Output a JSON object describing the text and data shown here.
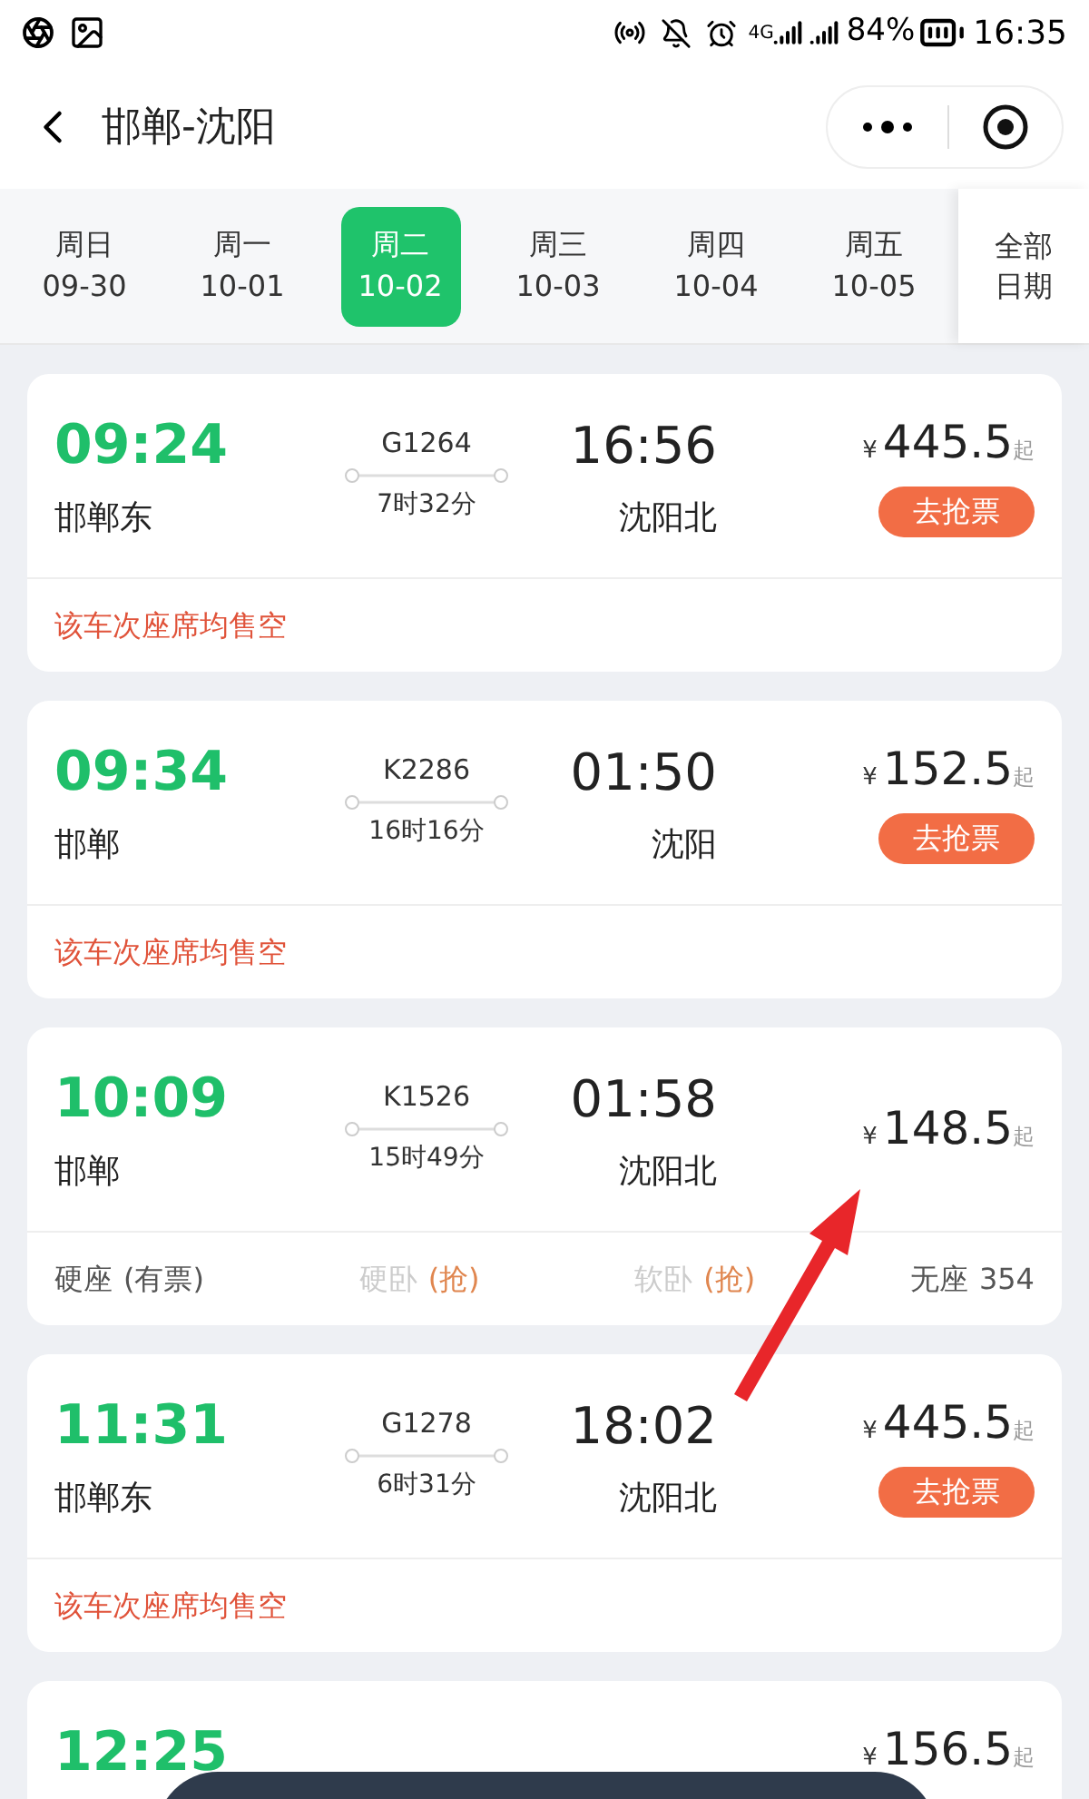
{
  "status_bar": {
    "network": "4G",
    "battery": "84%",
    "time": "16:35"
  },
  "header": {
    "title": "邯郸-沈阳"
  },
  "dates": [
    {
      "weekday": "周日",
      "date": "09-30",
      "selected": false
    },
    {
      "weekday": "周一",
      "date": "10-01",
      "selected": false
    },
    {
      "weekday": "周二",
      "date": "10-02",
      "selected": true
    },
    {
      "weekday": "周三",
      "date": "10-03",
      "selected": false
    },
    {
      "weekday": "周四",
      "date": "10-04",
      "selected": false
    },
    {
      "weekday": "周五",
      "date": "10-05",
      "selected": false
    }
  ],
  "all_dates": "全部日期",
  "trains": [
    {
      "kind": "sold_out",
      "dep_time": "09:24",
      "dep_station": "邯郸东",
      "train_no": "G1264",
      "duration": "7时32分",
      "arr_time": "16:56",
      "arr_station": "沈阳北",
      "currency": "¥",
      "price": "445.5",
      "price_suffix": "起",
      "button": "去抢票",
      "note": "该车次座席均售空"
    },
    {
      "kind": "sold_out",
      "dep_time": "09:34",
      "dep_station": "邯郸",
      "train_no": "K2286",
      "duration": "16时16分",
      "arr_time": "01:50",
      "arr_station": "沈阳",
      "currency": "¥",
      "price": "152.5",
      "price_suffix": "起",
      "button": "去抢票",
      "note": "该车次座席均售空"
    },
    {
      "kind": "seats",
      "dep_time": "10:09",
      "dep_station": "邯郸",
      "train_no": "K1526",
      "duration": "15时49分",
      "arr_time": "01:58",
      "arr_station": "沈阳北",
      "currency": "¥",
      "price": "148.5",
      "price_suffix": "起",
      "seats": [
        {
          "name": "硬座",
          "status": "(有票)",
          "available": true
        },
        {
          "name": "硬卧",
          "status": "(抢)",
          "available": false
        },
        {
          "name": "软卧",
          "status": "(抢)",
          "available": false
        },
        {
          "name": "无座",
          "status": "354",
          "available": true
        }
      ]
    },
    {
      "kind": "sold_out",
      "dep_time": "11:31",
      "dep_station": "邯郸东",
      "train_no": "G1278",
      "duration": "6时31分",
      "arr_time": "18:02",
      "arr_station": "沈阳北",
      "currency": "¥",
      "price": "445.5",
      "price_suffix": "起",
      "button": "去抢票",
      "note": "该车次座席均售空"
    },
    {
      "kind": "partial",
      "dep_time": "12:25",
      "currency": "¥",
      "price": "156.5",
      "price_suffix": "起"
    }
  ]
}
